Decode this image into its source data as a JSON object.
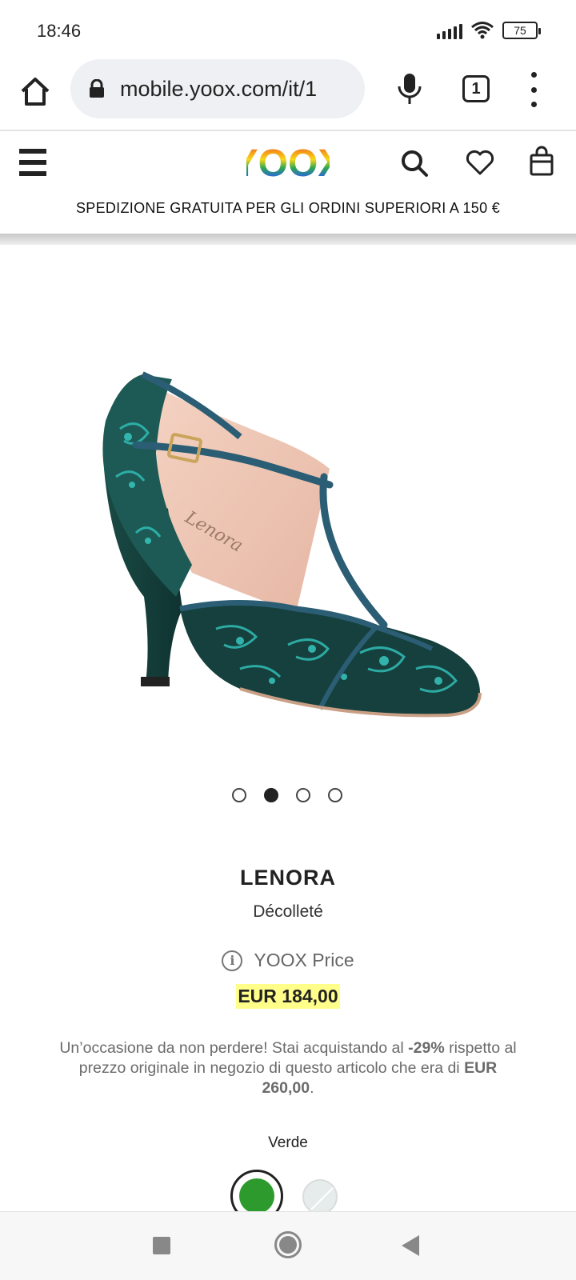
{
  "status_bar": {
    "time": "18:46",
    "battery": "75",
    "icons": [
      "signal-icon",
      "wifi-icon",
      "battery-icon"
    ]
  },
  "browser": {
    "url": "mobile.yoox.com/it/1",
    "tab_count": "1",
    "icons": [
      "home-icon",
      "lock-icon",
      "mic-icon",
      "tabs-icon",
      "overflow-menu-icon"
    ]
  },
  "site_header": {
    "logo_text": "YOOX",
    "logo_colors": [
      "#e8212a",
      "#f39019",
      "#f7d919",
      "#2fa84f",
      "#2a6bd1",
      "#7b3fb0"
    ],
    "shipping_banner": "SPEDIZIONE GRATUITA PER GLI ORDINI SUPERIORI A 150 €",
    "icons": [
      "menu-icon",
      "search-icon",
      "heart-icon",
      "shopping-bag-icon"
    ]
  },
  "product": {
    "image_dots": 4,
    "active_image_index": 1,
    "brand": "LENORA",
    "category": "Décolleté",
    "price_label": "YOOX Price",
    "price": "EUR 184,00",
    "promo": {
      "text_1": "Un’occasione da non perdere! Stai acquistando al ",
      "discount": "-29%",
      "text_2": " rispetto al prezzo originale in negozio di questo articolo che era di ",
      "original_price": "EUR 260,00",
      "text_3": "."
    },
    "color_name": "Verde",
    "swatches": [
      {
        "color": "#2c9a2c",
        "selected": true
      },
      {
        "color": "#e6ecec",
        "selected": false
      }
    ]
  },
  "nav_bar": {
    "icons": [
      "recent-apps-icon",
      "home-circle-icon",
      "back-icon"
    ]
  }
}
